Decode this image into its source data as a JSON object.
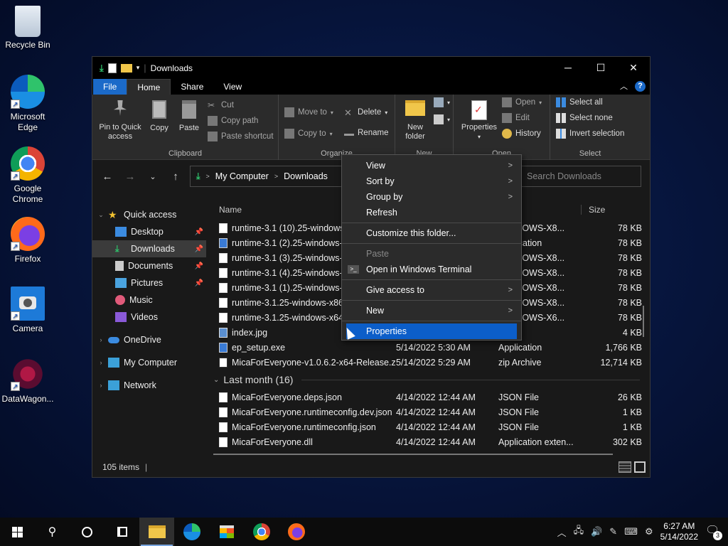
{
  "desktop": {
    "icons": [
      {
        "label": "Recycle Bin"
      },
      {
        "label": "Microsoft Edge"
      },
      {
        "label": "Google Chrome"
      },
      {
        "label": "Firefox"
      },
      {
        "label": "Camera"
      },
      {
        "label": "DataWagon..."
      }
    ]
  },
  "window": {
    "title": "Downloads",
    "tabs": {
      "file": "File",
      "home": "Home",
      "share": "Share",
      "view": "View"
    },
    "ribbon": {
      "clipboard": {
        "label": "Clipboard",
        "pin": "Pin to Quick access",
        "copy": "Copy",
        "paste": "Paste",
        "cut": "Cut",
        "copy_path": "Copy path",
        "paste_shortcut": "Paste shortcut"
      },
      "organize": {
        "label": "Organize",
        "move_to": "Move to",
        "copy_to": "Copy to",
        "delete": "Delete",
        "rename": "Rename"
      },
      "new": {
        "label": "New",
        "new_folder": "New folder"
      },
      "open": {
        "label": "Open",
        "properties": "Properties",
        "open": "Open",
        "edit": "Edit",
        "history": "History"
      },
      "select": {
        "label": "Select",
        "select_all": "Select all",
        "select_none": "Select none",
        "invert": "Invert selection"
      }
    },
    "address": {
      "root": "My Computer",
      "folder": "Downloads"
    },
    "search_placeholder": "Search Downloads",
    "nav": {
      "quick_access": "Quick access",
      "items": [
        "Desktop",
        "Downloads",
        "Documents",
        "Pictures",
        "Music",
        "Videos"
      ],
      "onedrive": "OneDrive",
      "my_computer": "My Computer",
      "network": "Network"
    },
    "columns": {
      "name": "Name",
      "size": "Size"
    },
    "files_today": [
      {
        "name": "runtime-3.1 (10).25-windows",
        "date": "",
        "type": "WINDOWS-X8...",
        "size": "78 KB",
        "icon": "file"
      },
      {
        "name": "runtime-3.1 (2).25-windows-",
        "date": "",
        "type": "Application",
        "size": "78 KB",
        "icon": "exe"
      },
      {
        "name": "runtime-3.1 (3).25-windows-",
        "date": "",
        "type": "WINDOWS-X8...",
        "size": "78 KB",
        "icon": "file"
      },
      {
        "name": "runtime-3.1 (4).25-windows-",
        "date": "",
        "type": "WINDOWS-X8...",
        "size": "78 KB",
        "icon": "file"
      },
      {
        "name": "runtime-3.1 (1).25-windows-",
        "date": "",
        "type": "WINDOWS-X8...",
        "size": "78 KB",
        "icon": "file"
      },
      {
        "name": "runtime-3.1.25-windows-x86",
        "date": "",
        "type": "WINDOWS-X8...",
        "size": "78 KB",
        "icon": "file"
      },
      {
        "name": "runtime-3.1.25-windows-x64",
        "date": "",
        "type": "WINDOWS-X6...",
        "size": "78 KB",
        "icon": "file"
      },
      {
        "name": "index.jpg",
        "date": "",
        "type": "File",
        "size": "4 KB",
        "icon": "img"
      },
      {
        "name": "ep_setup.exe",
        "date": "5/14/2022 5:30 AM",
        "type": "Application",
        "size": "1,766 KB",
        "icon": "exe"
      },
      {
        "name": "MicaForEveryone-v1.0.6.2-x64-Release.zip",
        "date": "5/14/2022 5:29 AM",
        "type": "zip Archive",
        "size": "12,714 KB",
        "icon": "zip"
      }
    ],
    "group_last_month": "Last month (16)",
    "files_last_month": [
      {
        "name": "MicaForEveryone.deps.json",
        "date": "4/14/2022 12:44 AM",
        "type": "JSON File",
        "size": "26 KB",
        "icon": "file"
      },
      {
        "name": "MicaForEveryone.runtimeconfig.dev.json",
        "date": "4/14/2022 12:44 AM",
        "type": "JSON File",
        "size": "1 KB",
        "icon": "file"
      },
      {
        "name": "MicaForEveryone.runtimeconfig.json",
        "date": "4/14/2022 12:44 AM",
        "type": "JSON File",
        "size": "1 KB",
        "icon": "file"
      },
      {
        "name": "MicaForEveryone.dll",
        "date": "4/14/2022 12:44 AM",
        "type": "Application exten...",
        "size": "302 KB",
        "icon": "file"
      }
    ],
    "status": "105 items"
  },
  "context_menu": {
    "view": "View",
    "sort_by": "Sort by",
    "group_by": "Group by",
    "refresh": "Refresh",
    "customize": "Customize this folder...",
    "paste": "Paste",
    "open_terminal": "Open in Windows Terminal",
    "give_access": "Give access to",
    "new": "New",
    "properties": "Properties"
  },
  "taskbar": {
    "time": "6:27 AM",
    "date": "5/14/2022",
    "notifications": "3"
  }
}
